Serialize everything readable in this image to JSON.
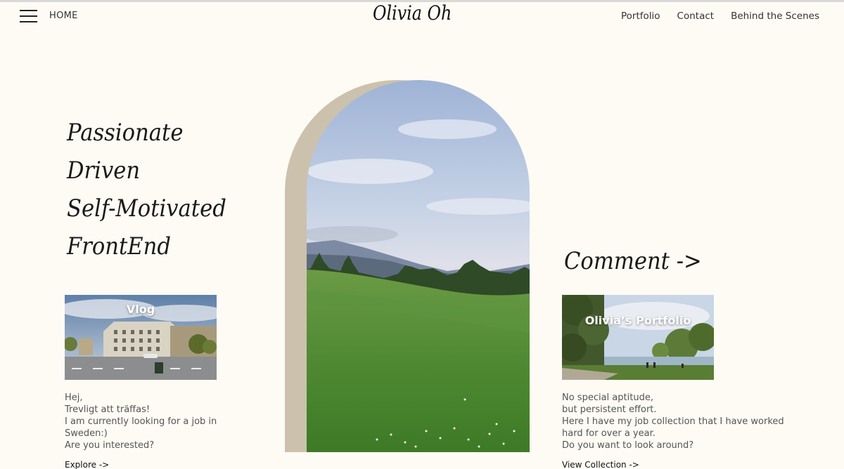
{
  "header": {
    "home_label": "HOME",
    "logo": "Olivia Oh",
    "nav": [
      "Portfolio",
      "Contact",
      "Behind the Scenes"
    ]
  },
  "tagline": [
    "Passionate",
    "Driven",
    "Self-Motivated",
    "FrontEnd"
  ],
  "comment_heading": "Comment ->",
  "vlog_card": {
    "title": "Vlog",
    "lines": [
      "Hej,",
      "Trevligt att träffas!",
      "I am currently looking for a job in",
      "Sweden:)",
      "Are you interested?"
    ],
    "cta": "Explore ->"
  },
  "portfolio_card": {
    "title": "Olivia’s Portfolio",
    "lines": [
      "No special aptitude,",
      "but persistent effort.",
      "Here I have my job collection that I have worked",
      "hard for over a year.",
      "Do you want to look around?"
    ],
    "cta": "View Collection ->"
  },
  "colors": {
    "background": "#fdfbf4",
    "arch_shadow": "#ccc1ad",
    "text": "#333333"
  },
  "icons": [
    "hamburger-menu-icon"
  ]
}
